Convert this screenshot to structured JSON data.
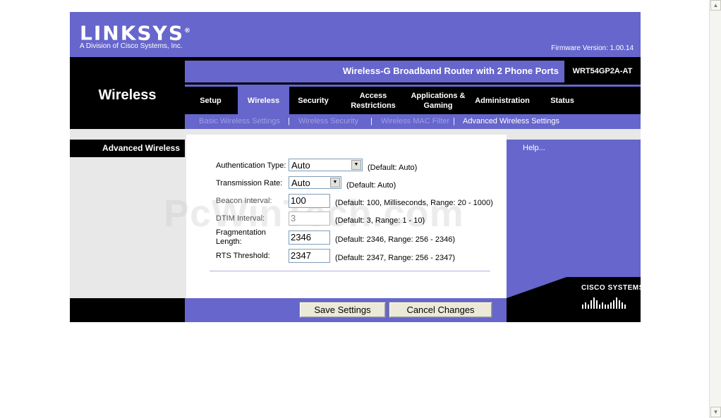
{
  "header": {
    "logo": "LINKSYS",
    "logo_mark": "®",
    "logo_subtitle": "A Division of Cisco Systems, Inc.",
    "firmware": "Firmware Version: 1.00.14"
  },
  "band": {
    "section": "Wireless",
    "product_name": "Wireless-G Broadband Router with 2 Phone Ports",
    "model": "WRT54GP2A-AT"
  },
  "tabs": [
    {
      "label": "Setup"
    },
    {
      "label": "Wireless"
    },
    {
      "label": "Security"
    },
    {
      "label": "Access Restrictions"
    },
    {
      "label": "Applications & Gaming"
    },
    {
      "label": "Administration"
    },
    {
      "label": "Status"
    }
  ],
  "subnav": [
    {
      "label": "Basic Wireless Settings"
    },
    {
      "label": "Wireless Security"
    },
    {
      "label": "Wireless MAC Filter"
    },
    {
      "label": "Advanced Wireless Settings"
    }
  ],
  "subnav_separator": "|",
  "section_title": "Advanced Wireless",
  "help_link": "Help...",
  "form": {
    "auth_type": {
      "label": "Authentication Type:",
      "value": "Auto",
      "hint": "(Default: Auto)"
    },
    "tx_rate": {
      "label": "Transmission Rate:",
      "value": "Auto",
      "hint": "(Default: Auto)"
    },
    "beacon": {
      "label": "Beacon Interval:",
      "value": "100",
      "hint": "(Default: 100, Milliseconds, Range: 20 - 1000)"
    },
    "dtim": {
      "label": "DTIM Interval:",
      "value": "3",
      "hint": "(Default: 3, Range: 1 - 10)"
    },
    "frag": {
      "label": "Fragmentation Length:",
      "value": "2346",
      "hint": "(Default: 2346, Range: 256 - 2346)"
    },
    "rts": {
      "label": "RTS Threshold:",
      "value": "2347",
      "hint": "(Default: 2347, Range: 256 - 2347)"
    }
  },
  "buttons": {
    "save": "Save Settings",
    "cancel": "Cancel Changes"
  },
  "cisco": {
    "text": "CISCO SYSTEMS"
  },
  "watermark": "PcWinTech.com",
  "colors": {
    "brand": "#6666cc",
    "black": "#000000",
    "subnav_inactive": "#a0a0e0"
  }
}
